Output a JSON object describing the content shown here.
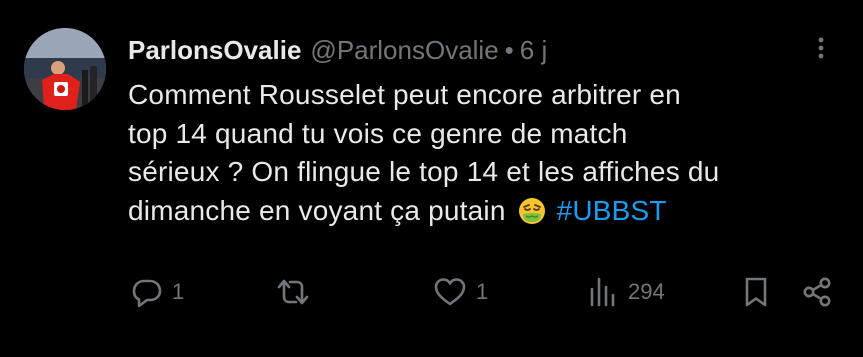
{
  "author": {
    "display_name": "ParlonsOvalie",
    "handle": "@ParlonsOvalie",
    "separator": "•",
    "time": "6 j"
  },
  "post": {
    "lines": [
      "Comment Rousselet peut encore arbitrer en",
      "top 14 quand tu vois ce genre de match",
      "sérieux ? On flingue le top 14 et les affiches du",
      "dimanche en voyant ça putain"
    ],
    "emoji": "nauseated-face",
    "hashtag": "#UBBST"
  },
  "actions": {
    "replies": "1",
    "reposts": "",
    "likes": "1",
    "views": "294"
  },
  "icons": {
    "more": "more-vertical-icon",
    "reply": "reply-icon",
    "repost": "repost-icon",
    "like": "heart-icon",
    "views": "views-icon",
    "bookmark": "bookmark-icon",
    "share": "share-icon"
  },
  "colors": {
    "background": "#000000",
    "text": "#e7e9ea",
    "secondary": "#71767b",
    "link": "#1d9bf0"
  }
}
